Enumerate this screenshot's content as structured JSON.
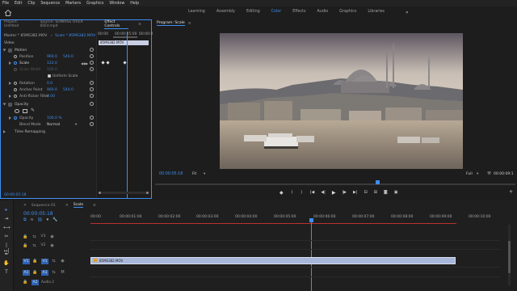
{
  "menu": [
    "File",
    "Edit",
    "Clip",
    "Sequence",
    "Markers",
    "Graphics",
    "Window",
    "Help"
  ],
  "workspaces": [
    {
      "label": "Learning",
      "active": false
    },
    {
      "label": "Assembly",
      "active": false
    },
    {
      "label": "Editing",
      "active": false
    },
    {
      "label": "Color",
      "active": true
    },
    {
      "label": "Effects",
      "active": false
    },
    {
      "label": "Audio",
      "active": false
    },
    {
      "label": "Graphics",
      "active": false
    },
    {
      "label": "Libraries",
      "active": false
    }
  ],
  "workspaces_more": "»",
  "project_tab": "Project: Untitled",
  "source_tab": "Source: SUNRISE OVER IDEV.mp4",
  "effect_controls_tab": "Effect Controls",
  "effect_controls_more": "≡",
  "ec_header": {
    "master": "Master * 85MS382.MOV",
    "clip": "Scale * 85MS382.MOV"
  },
  "ec_ruler": {
    "t0": "00:00",
    "t1": "00:00:05:00",
    "t2": "00:00:0"
  },
  "ec_clipbar": "85MS382.MOV",
  "video_label": "Video",
  "motion": {
    "title": "Motion",
    "position_label": "Position",
    "position_x": "960.0",
    "position_y": "540.0",
    "scale_label": "Scale",
    "scale_val": "122.0",
    "scale_width_label": "Scale Width",
    "scale_width_val": "100.0",
    "uniform_label": "Uniform Scale",
    "rotation_label": "Rotation",
    "rotation_val": "0.0",
    "anchor_label": "Anchor Point",
    "anchor_x": "960.0",
    "anchor_y": "540.0",
    "antiflicker_label": "Anti-flicker Filter",
    "antiflicker_val": "0.00"
  },
  "opacity": {
    "title": "Opacity",
    "opacity_label": "Opacity",
    "opacity_val": "100.0 %",
    "blend_label": "Blend Mode",
    "blend_val": "Normal"
  },
  "time_remap": "Time Remapping",
  "ec_timecode": "00:00:05:18",
  "program": {
    "title": "Program: Scale",
    "menu": "≡",
    "timecode": "00:00:05:18",
    "fit": "Fit",
    "quality": "Full",
    "duration": "00:00:09:1"
  },
  "timeline": {
    "tab": "Sequence 01",
    "tab_active": "Scale",
    "timecode": "00:00:05:18",
    "ruler": [
      "00:00",
      "00:00:01:00",
      "00:00:02:00",
      "00:00:03:00",
      "00:00:04:00",
      "00:00:05:00",
      "00:00:06:00",
      "00:00:07:00",
      "00:00:08:00",
      "00:00:09:00",
      "00:00:10:00"
    ],
    "tracks": [
      {
        "name": "V3"
      },
      {
        "name": "V2"
      },
      {
        "name": "V1"
      },
      {
        "name": "A1"
      },
      {
        "name": "A2",
        "label": "Audio 2"
      }
    ],
    "clip_label": "85MS382.MOV"
  },
  "colors": {
    "accent": "#3f8ef0",
    "clip": "#a8b6d9",
    "bg": "#1d1d1d"
  }
}
